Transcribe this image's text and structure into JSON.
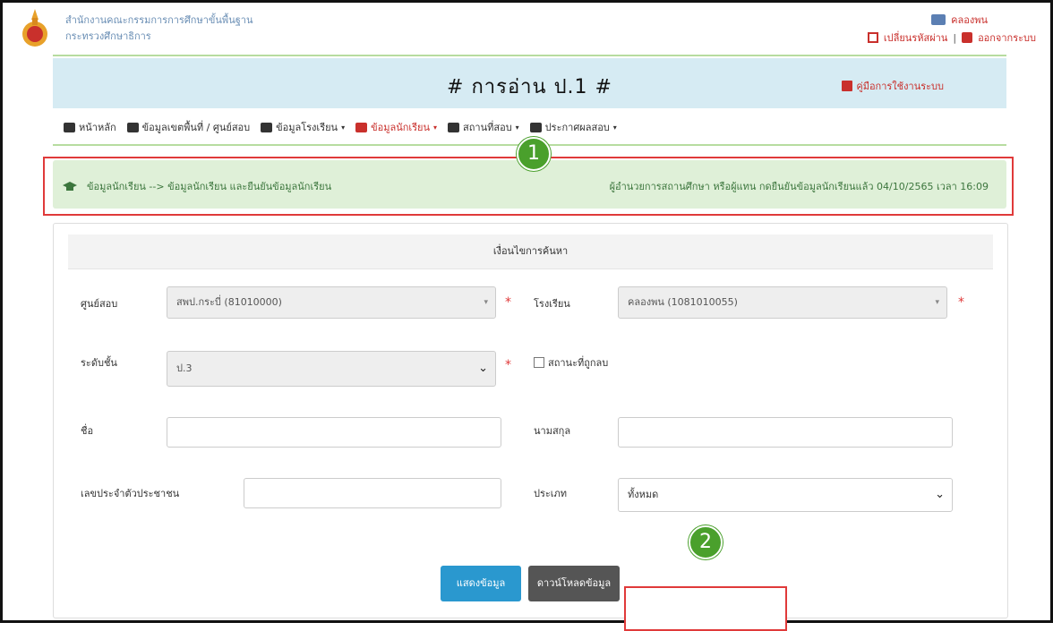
{
  "header": {
    "org_line1": "สำนักงานคณะกรรมการการศึกษาขั้นพื้นฐาน",
    "org_line2": "กระทรวงศึกษาธิการ",
    "user_name": "คลองพน",
    "change_password": "เปลี่ยนรหัสผ่าน",
    "separator": "|",
    "logout": "ออกจากระบบ"
  },
  "banner": {
    "title": "# การอ่าน ป.1 #",
    "manual": "คู่มือการใช้งานระบบ"
  },
  "nav": {
    "items": [
      {
        "label": "หน้าหลัก",
        "icon": "home-icon"
      },
      {
        "label": "ข้อมูลเขตพื้นที่ / ศูนย์สอบ",
        "icon": "bank-icon"
      },
      {
        "label": "ข้อมูลโรงเรียน",
        "icon": "briefcase-icon"
      },
      {
        "label": "ข้อมูลนักเรียน",
        "icon": "graduation-cap-icon"
      },
      {
        "label": "สถานที่สอบ",
        "icon": "table-icon"
      },
      {
        "label": "ประกาศผลสอบ",
        "icon": "bullhorn-icon"
      }
    ],
    "caret": "▾"
  },
  "alert": {
    "breadcrumb": "ข้อมูลนักเรียน --> ข้อมูลนักเรียน และยืนยันข้อมูลนักเรียน",
    "status": "ผู้อำนวยการสถานศึกษา หรือผู้แทน กดยืนยันข้อมูลนักเรียนแล้ว 04/10/2565 เวลา 16:09"
  },
  "markers": {
    "one": "1",
    "two": "2"
  },
  "form": {
    "title": "เงื่อนไขการค้นหา",
    "center_label": "ศูนย์สอบ",
    "center_value": "สพป.กระบี่ (81010000)",
    "school_label": "โรงเรียน",
    "school_value": "คลองพน (1081010055)",
    "level_label": "ระดับชั้น",
    "level_value": "ป.3",
    "deleted_label": "สถานะที่ถูกลบ",
    "firstname_label": "ชื่อ",
    "lastname_label": "นามสกุล",
    "idcard_label": "เลขประจำตัวประชาชน",
    "type_label": "ประเภท",
    "type_value": "ทั้งหมด",
    "required_mark": "*"
  },
  "buttons": {
    "show": "แสดงข้อมูล",
    "download": "ดาวน์โหลดข้อมูล"
  },
  "colors": {
    "accent_red": "#c9302c",
    "banner_bg": "#d6ebf3",
    "alert_bg": "#dff0d8",
    "primary_btn": "#2a98cf",
    "marker_green": "#4aa02c"
  }
}
